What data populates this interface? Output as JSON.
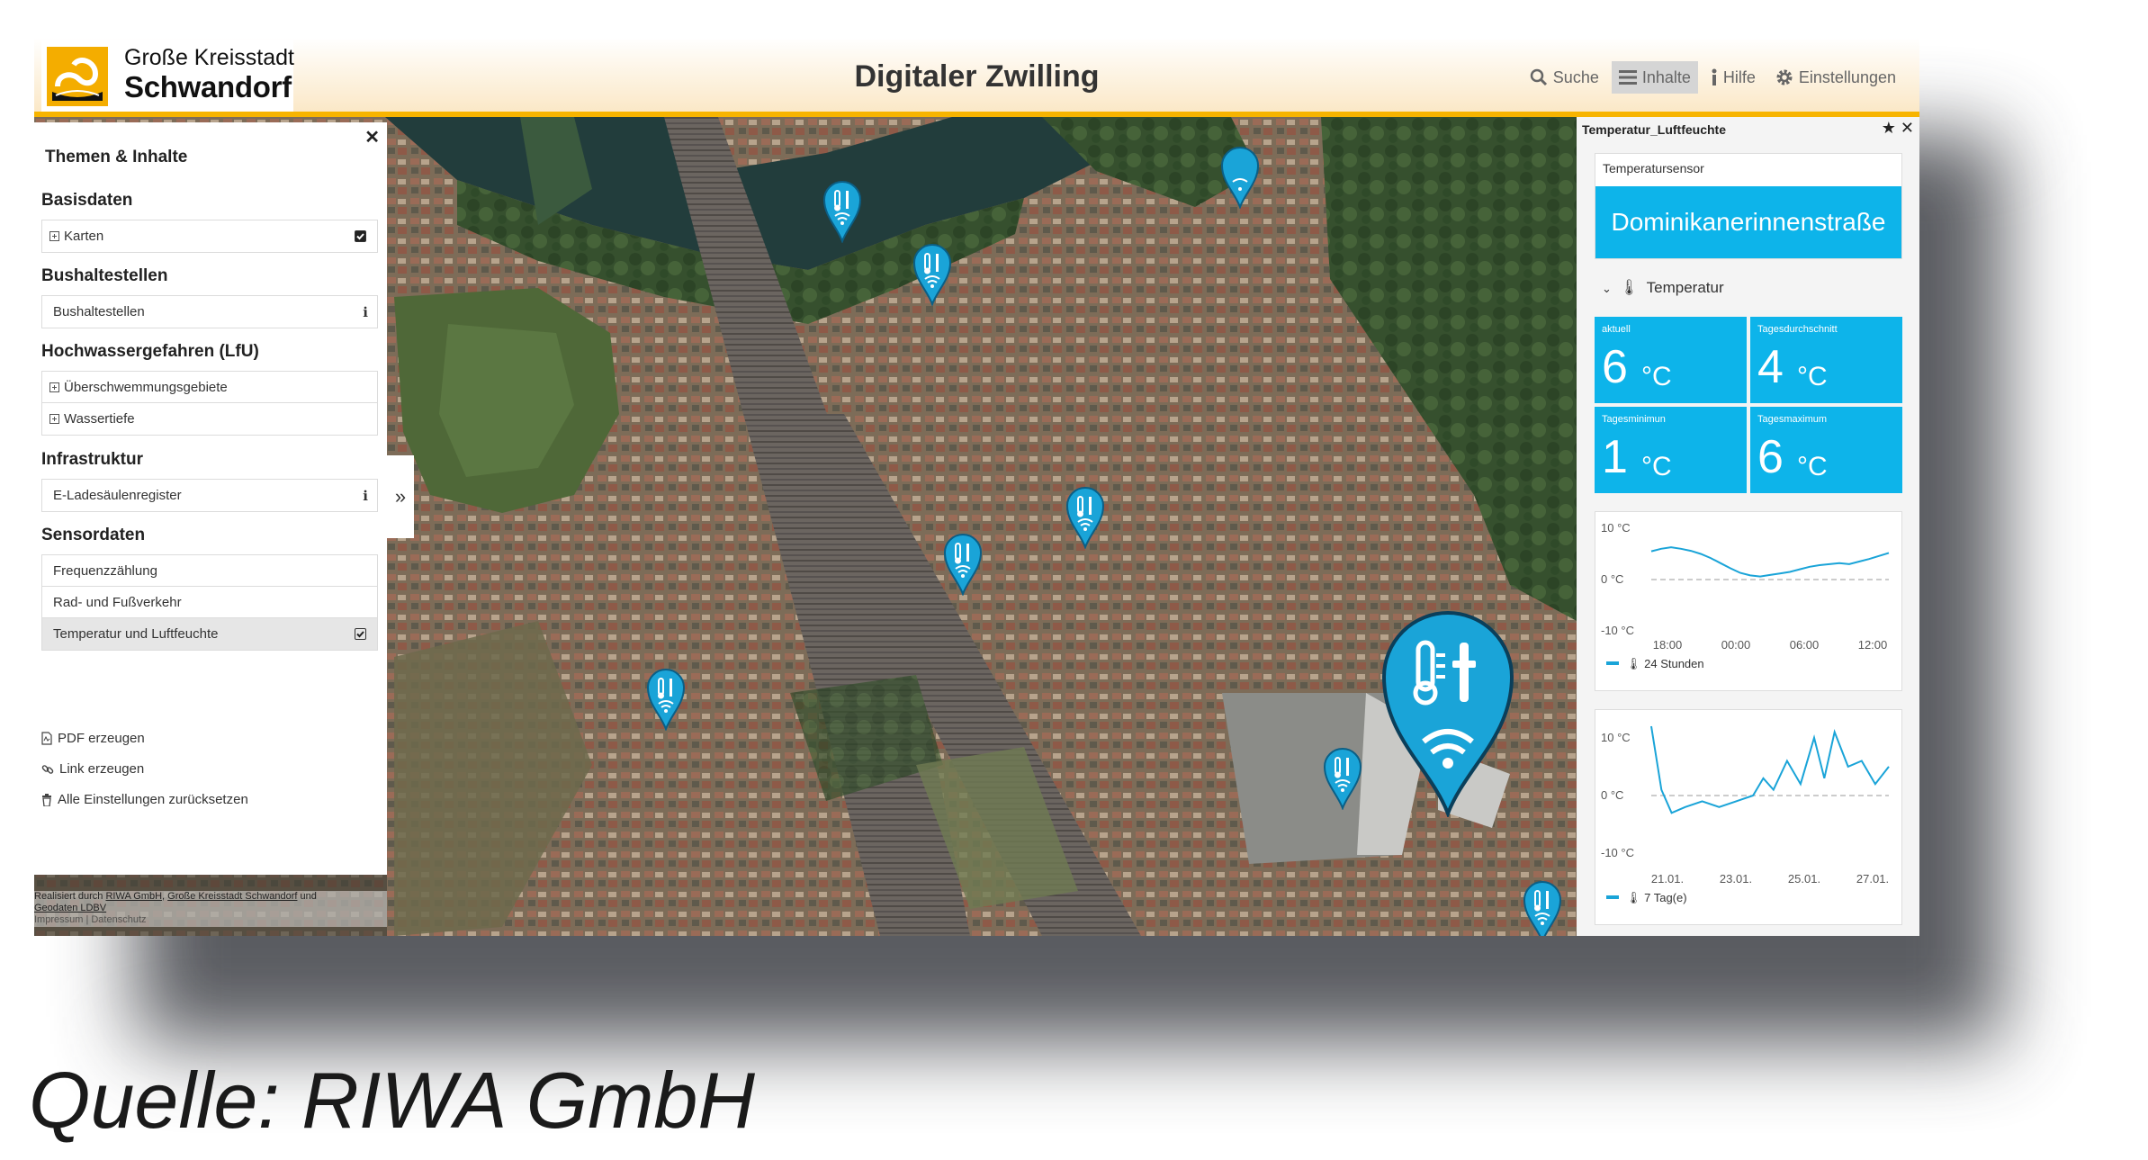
{
  "header": {
    "city_line1": "Große Kreisstadt",
    "city_line2": "Schwandorf",
    "app_title": "Digitaler Zwilling",
    "nav": [
      {
        "label": "Suche",
        "icon": "search-icon"
      },
      {
        "label": "Inhalte",
        "icon": "menu-icon",
        "active": true
      },
      {
        "label": "Hilfe",
        "icon": "info-icon"
      },
      {
        "label": "Einstellungen",
        "icon": "gear-icon"
      }
    ]
  },
  "sidebar": {
    "title": "Themen & Inhalte",
    "sections": [
      {
        "heading": "Basisdaten",
        "items": [
          {
            "label": "Karten",
            "expand": true,
            "control": "checkbox-checked"
          }
        ]
      },
      {
        "heading": "Bushaltestellen",
        "items": [
          {
            "label": "Bushaltestellen",
            "control": "info"
          }
        ]
      },
      {
        "heading": "Hochwassergefahren (LfU)",
        "items": [
          {
            "label": "Überschwemmungsgebiete",
            "expand": true
          },
          {
            "label": "Wassertiefe",
            "expand": true
          }
        ]
      },
      {
        "heading": "Infrastruktur",
        "items": [
          {
            "label": "E-Ladesäulenregister",
            "control": "info"
          }
        ]
      },
      {
        "heading": "Sensordaten",
        "items": [
          {
            "label": "Frequenzzählung"
          },
          {
            "label": "Rad- und Fußverkehr"
          },
          {
            "label": "Temperatur und Luftfeuchte",
            "control": "checkbox-checked",
            "selected": true
          }
        ]
      }
    ],
    "actions": [
      {
        "label": "PDF erzeugen",
        "icon": "file-pdf-icon"
      },
      {
        "label": "Link erzeugen",
        "icon": "link-icon"
      },
      {
        "label": "Alle Einstellungen zurücksetzen",
        "icon": "trash-icon"
      }
    ],
    "attribution": {
      "prefix": "Realisiert durch",
      "link1": "RIWA GmbH",
      "sep": ",",
      "link2": "Große Kreisstadt Schwandorf",
      "and": "und",
      "link3": "Geodaten LDBV",
      "line3": "Impressum | Datenschutz"
    }
  },
  "panel": {
    "title": "Temperatur_Luftfeuchte",
    "sensor_label": "Temperatursensor",
    "sensor_name": "Dominikanerinnenstraße",
    "section": "Temperatur",
    "unit": "°C",
    "tiles": [
      {
        "label": "aktuell",
        "value": "6"
      },
      {
        "label": "Tagesdurchschnitt",
        "value": "4"
      },
      {
        "label": "Tagesminimun",
        "value": "1"
      },
      {
        "label": "Tagesmaximum",
        "value": "6"
      }
    ],
    "charts": [
      {
        "type": "line",
        "y_ticks": [
          "10 °C",
          "0 °C",
          "-10 °C"
        ],
        "ylim": [
          -10,
          10
        ],
        "x_ticks": [
          "18:00",
          "00:00",
          "06:00",
          "12:00"
        ],
        "legend": "24 Stunden",
        "color": "#1aa4d8",
        "x": [
          0,
          1,
          2,
          3,
          4,
          5,
          6,
          7,
          8,
          9,
          10,
          11,
          12,
          13,
          14,
          15,
          16,
          17,
          18,
          19,
          20,
          21,
          22,
          23,
          24
        ],
        "values": [
          5.5,
          6.0,
          6.3,
          6.0,
          5.6,
          5.0,
          4.2,
          3.2,
          2.2,
          1.3,
          0.8,
          0.6,
          0.9,
          1.2,
          1.5,
          2.0,
          2.5,
          2.8,
          3.0,
          3.2,
          3.0,
          3.5,
          4.0,
          4.6,
          5.2
        ]
      },
      {
        "type": "line",
        "y_ticks": [
          "10 °C",
          "0 °C",
          "-10 °C"
        ],
        "ylim": [
          -12,
          12
        ],
        "x_ticks": [
          "21.01.",
          "23.01.",
          "25.01.",
          "27.01."
        ],
        "legend": "7 Tag(e)",
        "color": "#1aa4d8",
        "x": [
          0,
          0.3,
          0.6,
          1.0,
          1.5,
          2.0,
          2.5,
          3.0,
          3.3,
          3.6,
          4.0,
          4.4,
          4.8,
          5.1,
          5.4,
          5.8,
          6.2,
          6.6,
          7.0
        ],
        "values": [
          12,
          1,
          -3,
          -2,
          -1,
          -2,
          -1,
          0,
          3,
          1,
          6,
          2,
          10,
          3,
          11,
          5,
          6,
          2,
          5
        ]
      }
    ]
  },
  "map": {
    "markers_visible": 10,
    "highlighted_marker": "Dominikanerinnenstraße"
  },
  "caption": "Quelle: RIWA GmbH"
}
